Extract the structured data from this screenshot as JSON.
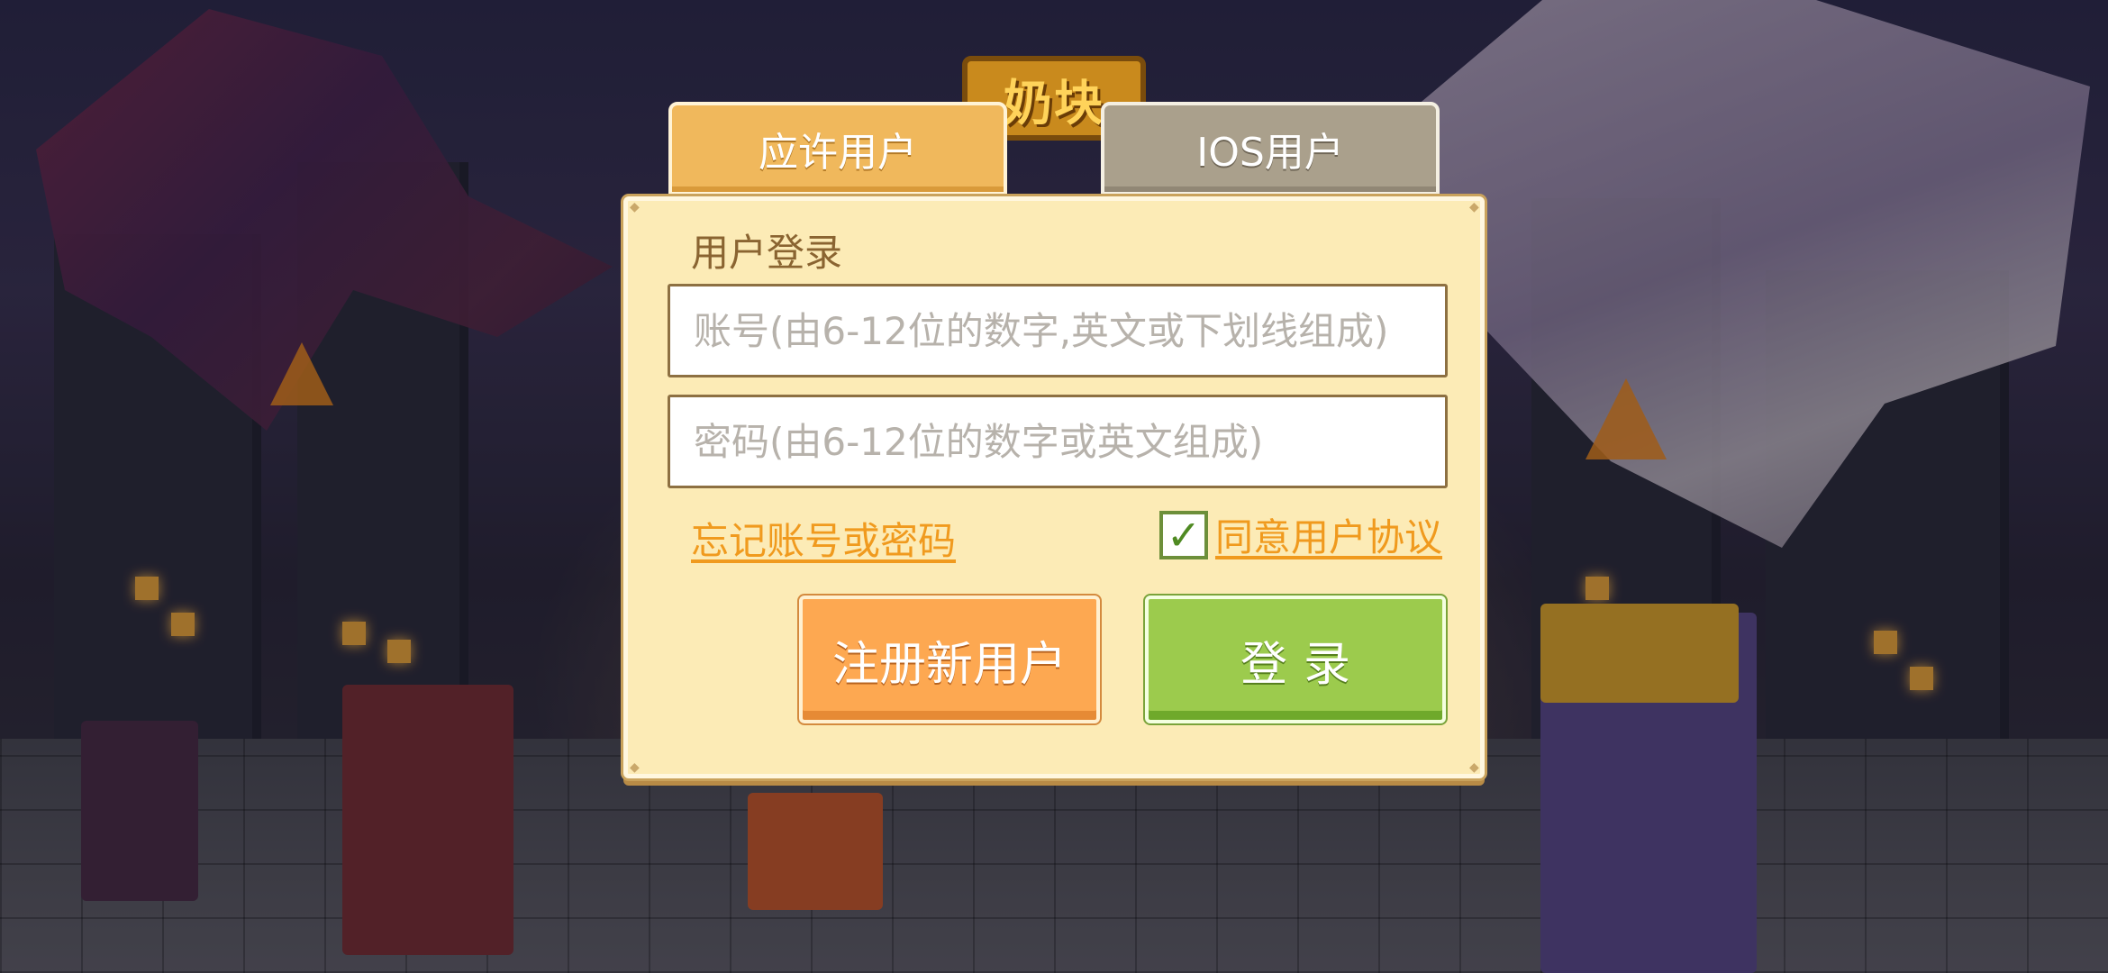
{
  "tabs": {
    "android": "应许用户",
    "ios": "IOS用户"
  },
  "logo": {
    "text": "奶块"
  },
  "login_panel": {
    "title": "用户登录",
    "account_placeholder": "账号(由6-12位的数字,英文或下划线组成)",
    "password_placeholder": "密码(由6-12位的数字或英文组成)",
    "forgot_link": "忘记账号或密码",
    "agree_checked": true,
    "agree_link": "同意用户协议",
    "register_button": "注册新用户",
    "login_button": "登录"
  },
  "colors": {
    "panel_bg": "#fcebb6",
    "tab_active": "#f0b85c",
    "tab_inactive": "#aaa08c",
    "link_orange": "#f09a1e",
    "register_orange": "#fda851",
    "login_green": "#9ccb4d"
  }
}
